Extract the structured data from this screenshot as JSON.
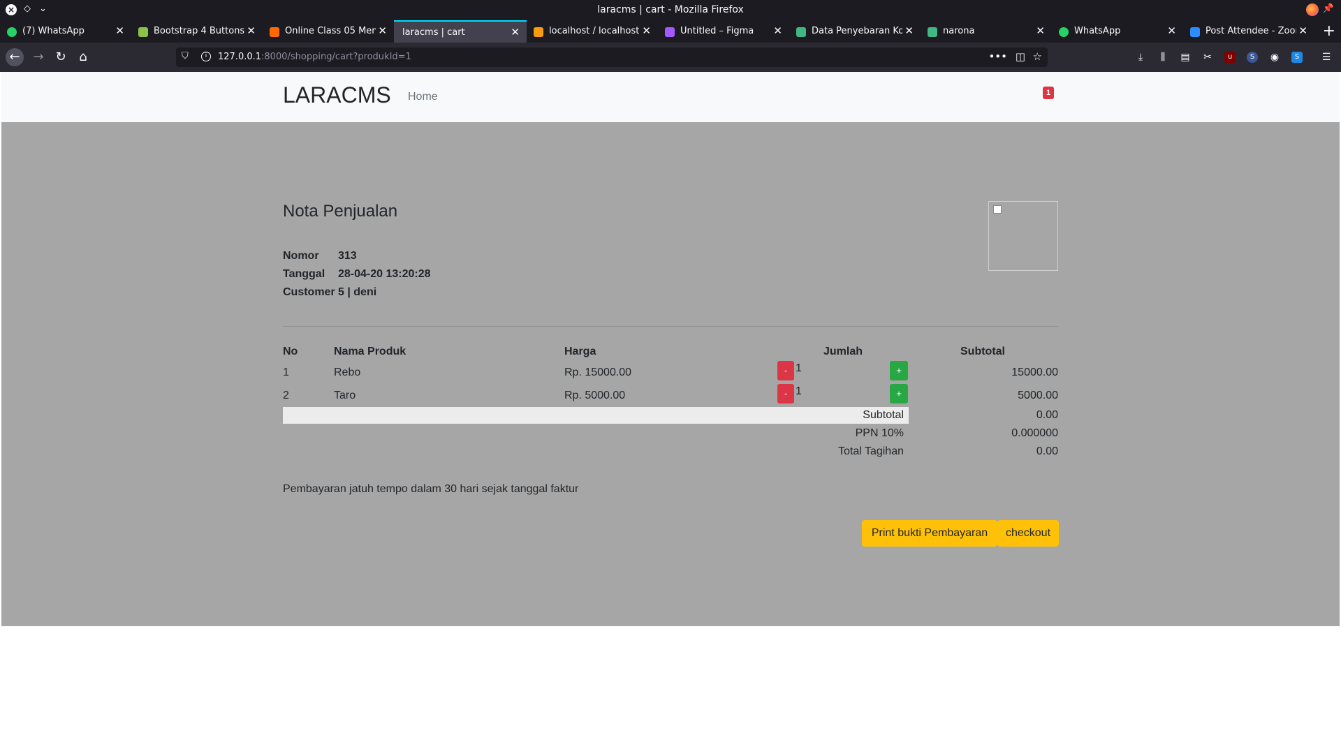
{
  "window": {
    "title": "laracms | cart - Mozilla Firefox"
  },
  "tabs": [
    {
      "label": "(7) WhatsApp",
      "favicon_color": "#25d366"
    },
    {
      "label": "Bootstrap 4 Buttons",
      "favicon_color": "#8bc34a"
    },
    {
      "label": "Online Class 05 Mem",
      "favicon_color": "#ff6a00"
    },
    {
      "label": "laracms | cart",
      "favicon_color": ""
    },
    {
      "label": "localhost / localhost",
      "favicon_color": "#f89c0e"
    },
    {
      "label": "Untitled – Figma",
      "favicon_color": "#a259ff"
    },
    {
      "label": "Data Penyebaran Kor",
      "favicon_color": "#41b883"
    },
    {
      "label": "narona",
      "favicon_color": "#41b883"
    },
    {
      "label": "WhatsApp",
      "favicon_color": "#25d366"
    },
    {
      "label": "Post Attendee - Zoom",
      "favicon_color": "#2d8cff"
    }
  ],
  "url": {
    "host": "127.0.0.1",
    "rest": ":8000/shopping/cart?produkId=1"
  },
  "site": {
    "brand": "LARACMS",
    "nav_home": "Home",
    "cart_count": "1"
  },
  "invoice": {
    "title": "Nota Penjualan",
    "meta": [
      {
        "key": "Nomor",
        "value": "313"
      },
      {
        "key": "Tanggal",
        "value": "28-04-20 13:20:28"
      },
      {
        "key": "Customer",
        "value": "5 | deni"
      }
    ],
    "headers": {
      "no": "No",
      "product": "Nama Produk",
      "price": "Harga",
      "qty": "Jumlah",
      "subtotal": "Subtotal"
    },
    "rows": [
      {
        "no": "1",
        "product": "Rebo",
        "price": "Rp. 15000.00",
        "qty": "1",
        "subtotal": "15000.00",
        "minus": "-",
        "plus": "+"
      },
      {
        "no": "2",
        "product": "Taro",
        "price": "Rp. 5000.00",
        "qty": "1",
        "subtotal": "5000.00",
        "minus": "-",
        "plus": "+"
      }
    ],
    "summary": [
      {
        "label": "Subtotal",
        "value": "0.00"
      },
      {
        "label": "PPN 10%",
        "value": "0.000000"
      },
      {
        "label": "Total Tagihan",
        "value": "0.00"
      }
    ],
    "terms": "Pembayaran jatuh tempo dalam 30 hari sejak tanggal faktur",
    "buttons": {
      "print": "Print bukti Pembayaran",
      "checkout": "checkout"
    }
  },
  "colors": {
    "overlay": "#a6a6a6",
    "danger": "#dc3545",
    "success": "#28a745",
    "warning": "#ffc107"
  }
}
